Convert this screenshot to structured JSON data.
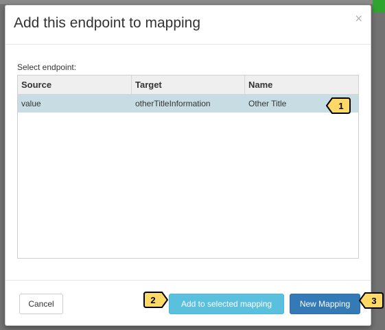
{
  "modal": {
    "title": "Add this endpoint to mapping",
    "close_label": "×",
    "select_label": "Select endpoint:",
    "table": {
      "columns": [
        "Source",
        "Target",
        "Name"
      ],
      "rows": [
        {
          "source": "value",
          "target": "otherTitleInformation",
          "name": "Other Title"
        }
      ]
    },
    "buttons": {
      "cancel": "Cancel",
      "add_to_selected": "Add to selected mapping",
      "new_mapping": "New Mapping"
    }
  },
  "callouts": [
    {
      "number": "1",
      "color": "#ffd966"
    },
    {
      "number": "2",
      "color": "#ffd966"
    },
    {
      "number": "3",
      "color": "#ffd966"
    }
  ]
}
